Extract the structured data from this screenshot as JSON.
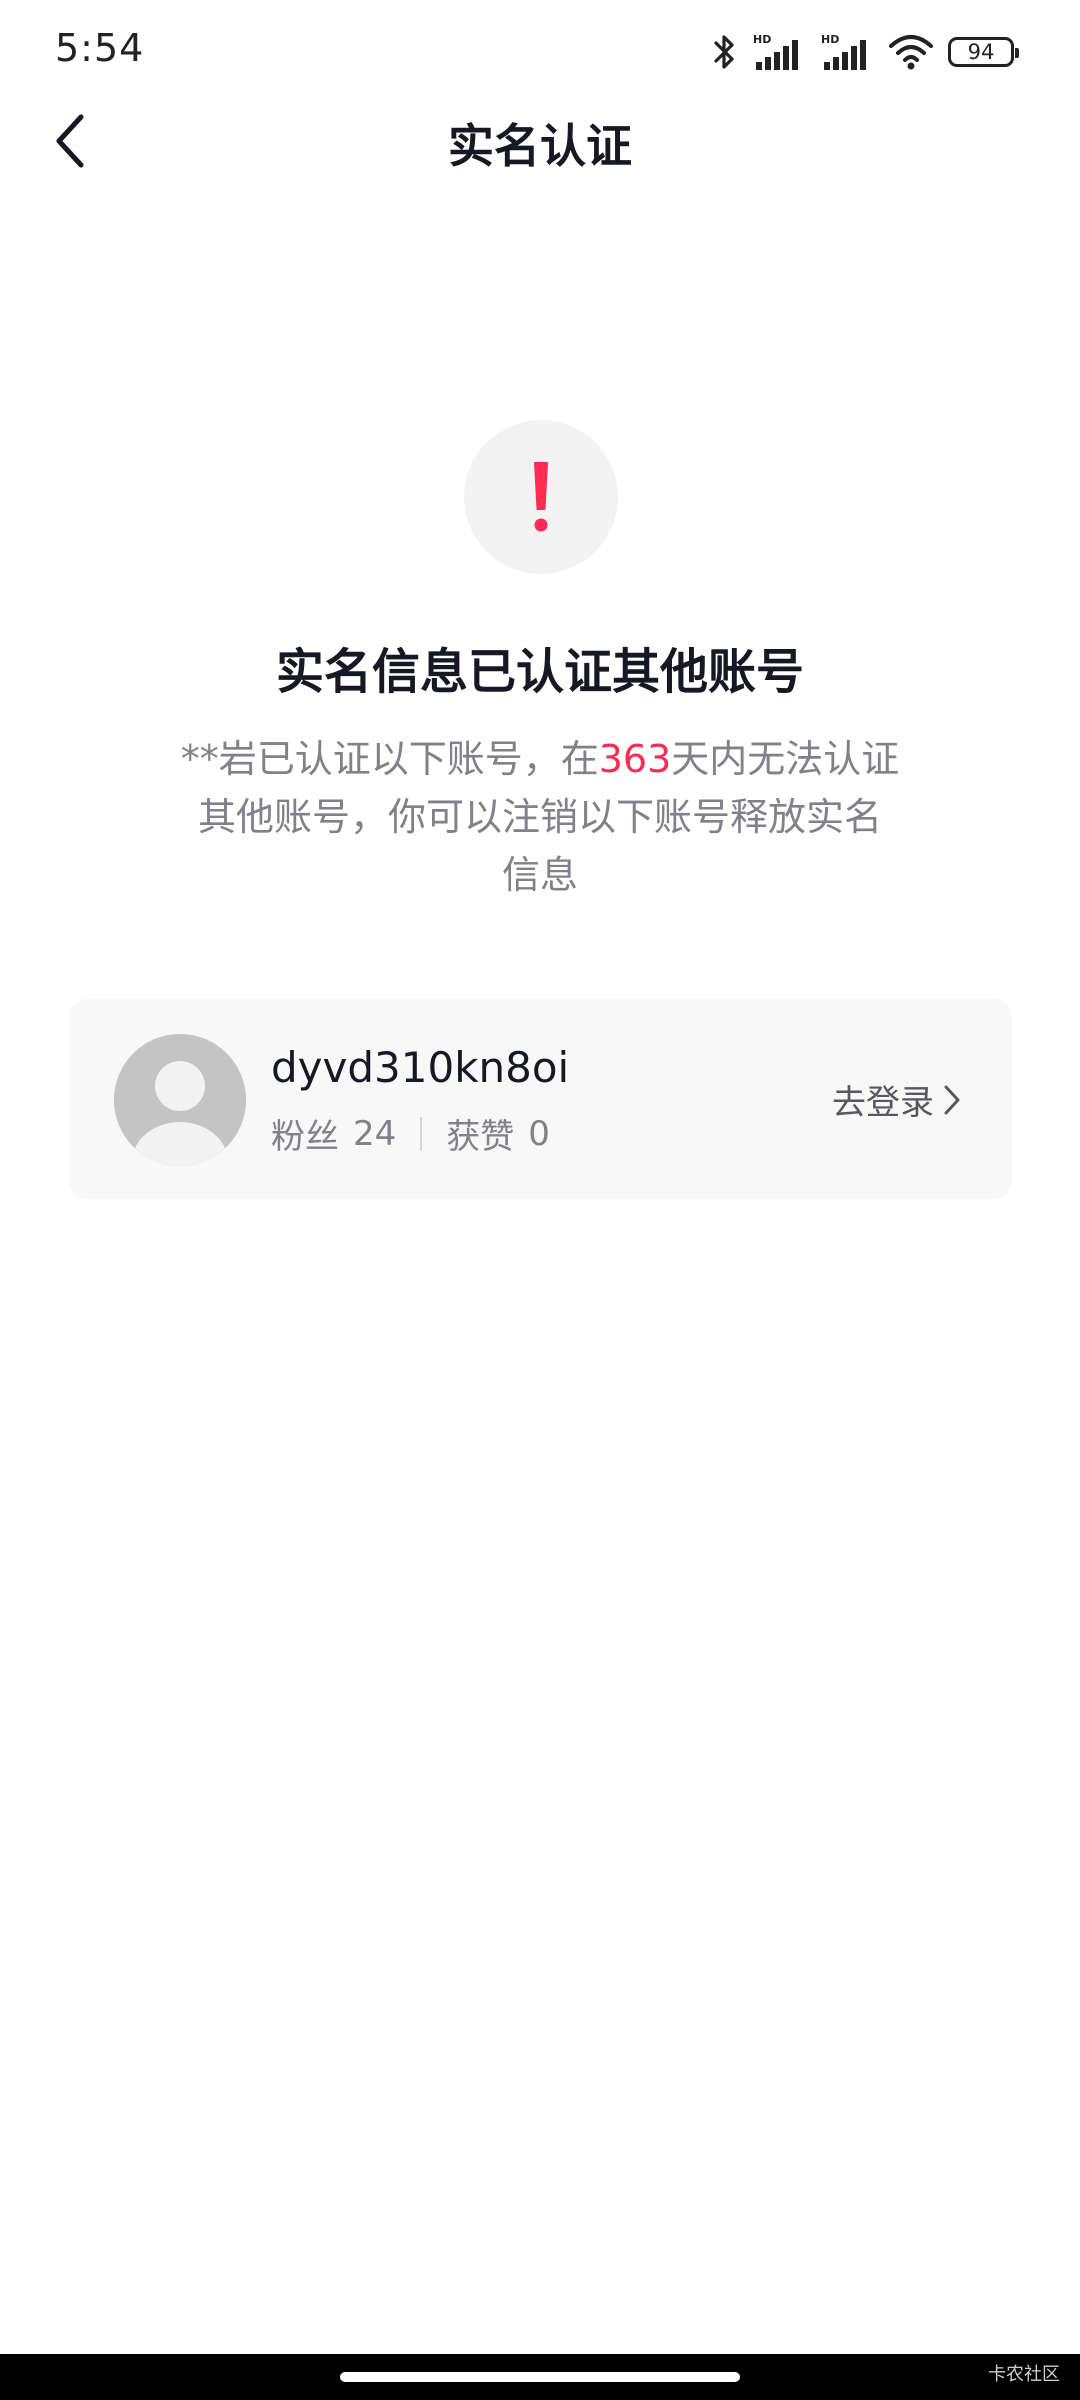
{
  "status_bar": {
    "time": "5:54",
    "battery": "94",
    "icons": [
      "bluetooth-icon",
      "hd-signal-icon",
      "hd-signal-icon",
      "wifi-icon",
      "battery-icon"
    ]
  },
  "nav": {
    "title": "实名认证",
    "back_icon": "chevron-left-icon"
  },
  "warning": {
    "icon": "exclamation-icon",
    "icon_color": "#fe2c55",
    "headline": "实名信息已认证其他账号",
    "description_before": "**岩已认证以下账号，在",
    "description_highlight": "363",
    "description_after": "天内无法认证其他账号，你可以注销以下账号释放实名信息"
  },
  "account": {
    "username": "dyvd310kn8oi",
    "followers_label": "粉丝",
    "followers_count": "24",
    "likes_label": "获赞",
    "likes_count": "0",
    "action_label": "去登录"
  },
  "footer": {
    "watermark": "卡农社区"
  },
  "colors": {
    "accent": "#fe2c55",
    "text_primary": "#161823",
    "text_secondary": "#80818a",
    "card_bg": "#f8f8f8"
  }
}
